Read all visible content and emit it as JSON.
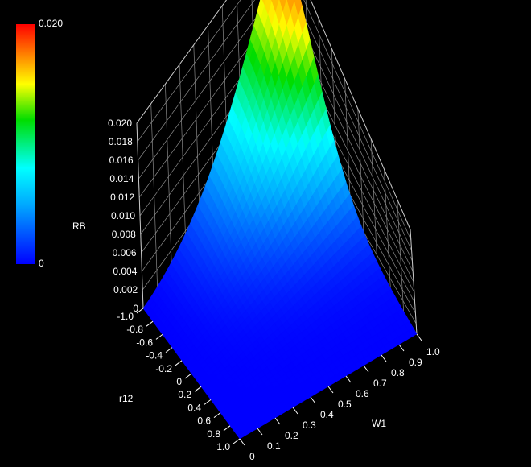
{
  "chart_data": {
    "type": "surface3d",
    "zlabel": "RB",
    "xlabel": "r12",
    "ylabel": "W1",
    "zlim": [
      0,
      0.02
    ],
    "xlim": [
      -1.0,
      1.0
    ],
    "ylim": [
      0,
      1.0
    ],
    "z_ticks": [
      "0",
      "0.002",
      "0.004",
      "0.006",
      "0.008",
      "0.010",
      "0.012",
      "0.014",
      "0.016",
      "0.018",
      "0.020"
    ],
    "x_ticks": [
      "-1.0",
      "-0.8",
      "-0.6",
      "-0.4",
      "-0.2",
      "0",
      "0.2",
      "0.4",
      "0.6",
      "0.8",
      "1.0"
    ],
    "y_ticks": [
      "0",
      "0.1",
      "0.2",
      "0.3",
      "0.4",
      "0.5",
      "0.6",
      "0.7",
      "0.8",
      "0.9",
      "1.0"
    ],
    "colorbar": {
      "min_label": "0",
      "max_label": "0.020",
      "colormap": "rainbow"
    },
    "grid": true,
    "peak": {
      "r12": -1.0,
      "W1": 1.0,
      "RB": 0.02
    }
  }
}
